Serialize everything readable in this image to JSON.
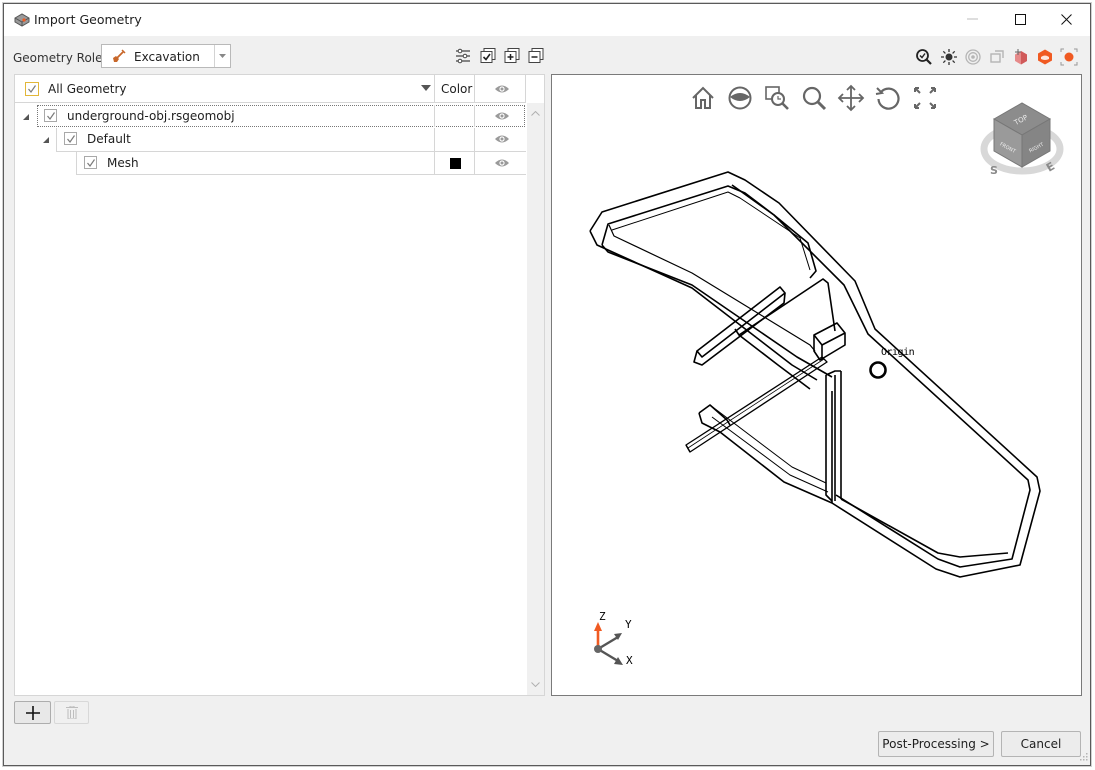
{
  "window": {
    "title": "Import Geometry",
    "icon": "geometry-app-icon",
    "controls": [
      "minimize",
      "maximize",
      "close"
    ]
  },
  "toolbar": {
    "role_label": "Geometry Role:",
    "role_value": "Excavation",
    "role_icon": "shovel-icon",
    "tree_tools": [
      "filter-settings-icon",
      "check-all-icon",
      "expand-all-icon",
      "collapse-all-icon"
    ],
    "viewport_tools": [
      "zoom-extents-icon",
      "lighting-icon",
      "target-icon",
      "rotate-view-icon",
      "move-object-icon",
      "cut-object-icon",
      "select-object-icon"
    ]
  },
  "tree": {
    "header": {
      "name_label": "All Geometry",
      "color_label": "Color",
      "visibility_icon": "eye-icon"
    },
    "rows": [
      {
        "label": "underground-obj.rsgeomobj",
        "checked": true,
        "expanded": true,
        "level": 0,
        "color": null,
        "visible": true
      },
      {
        "label": "Default",
        "checked": true,
        "expanded": true,
        "level": 1,
        "color": null,
        "visible": true
      },
      {
        "label": "Mesh",
        "checked": true,
        "expanded": false,
        "level": 2,
        "color": "#000000",
        "visible": true
      }
    ]
  },
  "viewport": {
    "nav_tools": [
      "home-icon",
      "look-icon",
      "zoom-window-icon",
      "zoom-icon",
      "pan-icon",
      "rotate-icon",
      "fullscreen-icon"
    ],
    "viewcube": {
      "faces": [
        "TOP",
        "FRONT",
        "RIGHT"
      ],
      "compass": [
        "S",
        "E"
      ]
    },
    "origin_label": "Origin",
    "axes": {
      "z": "Z",
      "y": "Y",
      "x": "X"
    }
  },
  "buttons": {
    "add_label": "+",
    "delete_icon": "trash-icon",
    "post_processing": "Post-Processing >",
    "cancel": "Cancel"
  },
  "colors": {
    "accent_orange": "#f05a22",
    "checkbox_highlight": "#e2b73a",
    "icon_gray": "#6b6b6b"
  }
}
